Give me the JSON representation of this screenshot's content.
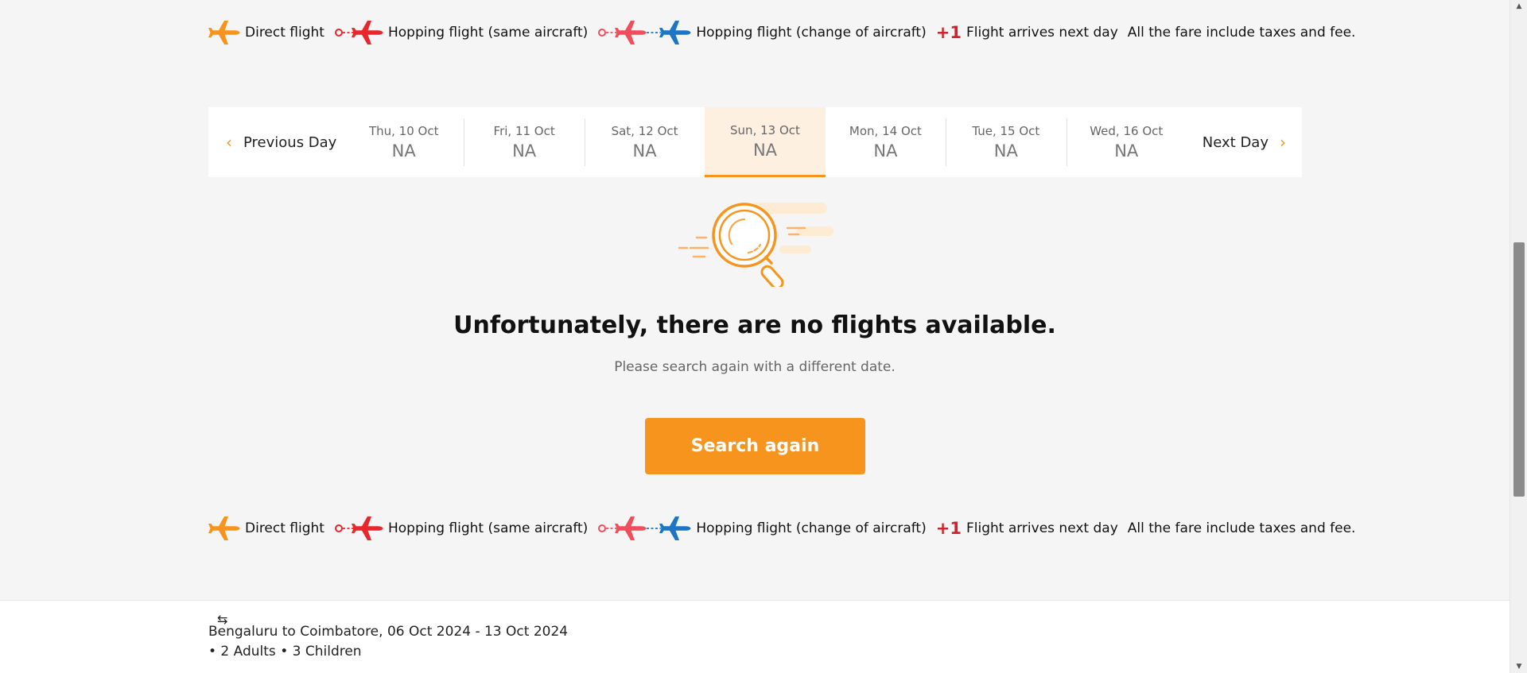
{
  "legend": {
    "direct": "Direct flight",
    "hopping_same": "Hopping flight (same aircraft)",
    "hopping_change": "Hopping flight (change of aircraft)",
    "plus_one": "+1",
    "next_day": "Flight arrives next day",
    "fare_note": "All the fare include taxes and fee."
  },
  "date_strip": {
    "prev_label": "Previous Day",
    "next_label": "Next Day",
    "days": [
      {
        "label": "Thu, 10 Oct",
        "price": "NA"
      },
      {
        "label": "Fri, 11 Oct",
        "price": "NA"
      },
      {
        "label": "Sat, 12 Oct",
        "price": "NA"
      },
      {
        "label": "Sun, 13 Oct",
        "price": "NA"
      },
      {
        "label": "Mon, 14 Oct",
        "price": "NA"
      },
      {
        "label": "Tue, 15 Oct",
        "price": "NA"
      },
      {
        "label": "Wed, 16 Oct",
        "price": "NA"
      }
    ],
    "selected_label": "Sun, 13 Oct"
  },
  "empty_state": {
    "title": "Unfortunately, there are no flights available.",
    "subtitle": "Please search again with a different date.",
    "button_label": "Search again"
  },
  "summary": {
    "swap_icon": "⇆",
    "route": "Bengaluru to Coimbatore, 06 Oct 2024 - 13 Oct 2024",
    "passengers": "• 2 Adults • 3 Children"
  },
  "colors": {
    "accent": "#f7941d",
    "direct_plane": "#f7941d",
    "hop_plane": "#e8262e",
    "change_plane": "#1d75c5",
    "plus_one": "#d0242c",
    "background": "#f5f5f5"
  },
  "icons": [
    "direct-flight-icon",
    "hopping-same-aircraft-icon",
    "hopping-change-aircraft-icon",
    "magnifier-illustration",
    "chevron-left-icon",
    "chevron-right-icon",
    "swap-icon"
  ]
}
